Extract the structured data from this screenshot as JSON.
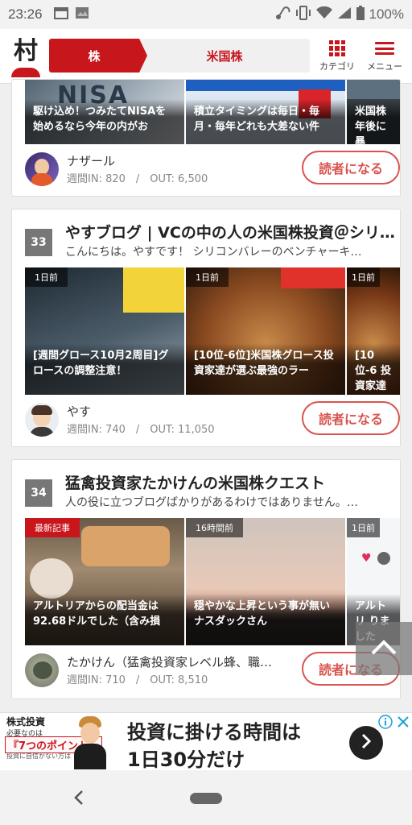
{
  "status_bar": {
    "time": "23:26",
    "battery": "100%"
  },
  "header": {
    "tabs": [
      {
        "label": "株"
      },
      {
        "label": "米国株"
      }
    ],
    "category_label": "カテゴリ",
    "menu_label": "メニュー"
  },
  "entries": [
    {
      "posts": [
        {
          "caption": "駆け込め！つみたてNISAを始めるなら今年の内がお"
        },
        {
          "caption": "積立タイミングは毎日・毎月・毎年どれも大差ない件"
        },
        {
          "caption": "米国株 年後に暴"
        }
      ],
      "author": "ナザール",
      "stats": "週間IN: 820　/　OUT: 6,500",
      "follow_label": "読者になる"
    },
    {
      "rank": "33",
      "title": "やすブログ | VCの中の人の米国株投資＠シリ…",
      "description": "こんにちは。やすです！ シリコンバレーのベンチャーキ…",
      "posts": [
        {
          "time": "1日前",
          "caption": "[週間グロース10月2周目]グロースの調整注意！"
        },
        {
          "time": "1日前",
          "caption": "[10位-6位]米国株グロース投資家達が選ぶ最強のラー"
        },
        {
          "time": "1日前",
          "caption": "[10位-6 投資家達"
        }
      ],
      "author": "やす",
      "stats": "週間IN: 740　/　OUT: 11,050",
      "follow_label": "読者になる"
    },
    {
      "rank": "34",
      "title": "猛禽投資家たかけんの米国株クエスト",
      "description": "人の役に立つブログばかりがあるわけではありません。…",
      "posts": [
        {
          "time": "最新記事",
          "caption": "アルトリアからの配当金は92.68ドルでした（含み損"
        },
        {
          "time": "16時間前",
          "caption": "穏やかな上昇という事が無いナスダックさん"
        },
        {
          "time": "1日前",
          "caption": "アルトリ りました"
        }
      ],
      "author": "たかけん（猛禽投資家レベル蜂、職…",
      "stats": "週間IN: 710　/　OUT: 8,510",
      "follow_label": "読者になる"
    }
  ],
  "ad": {
    "brand": "株式投資",
    "sub": "必要なのは",
    "highlight": "『7つのポイント』",
    "note": "投資に自信がない方は",
    "headline1": "投資に掛ける時間は",
    "headline2": "1日30分だけ"
  },
  "colors": {
    "brand_red": "#c8161d",
    "follow_red": "#d9534f"
  }
}
